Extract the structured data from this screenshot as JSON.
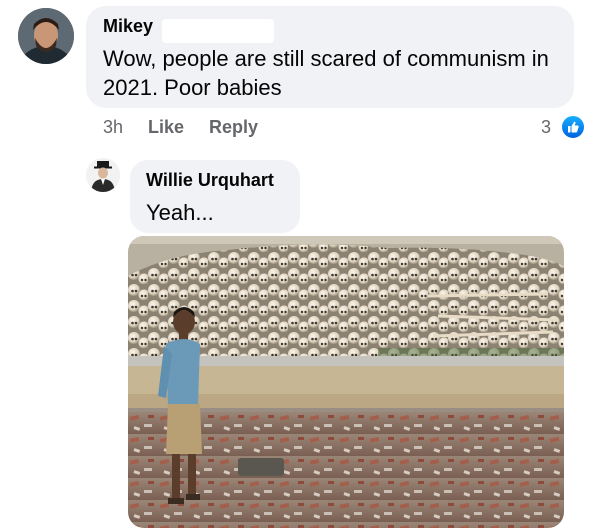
{
  "comment": {
    "author": "Mikey",
    "text": "Wow, people are still scared of communism in 2021. Poor babies",
    "time": "3h",
    "like_label": "Like",
    "reply_label": "Reply",
    "reaction_count": "3",
    "reaction_icon": "thumbs-up-icon"
  },
  "reply": {
    "author": "Willie Urquhart",
    "text": "Yeah...",
    "attachment_icon": "photo-attachment"
  },
  "colors": {
    "bubble": "#f0f2f5",
    "meta_text": "#65676b",
    "like_blue": "#1877f2"
  }
}
